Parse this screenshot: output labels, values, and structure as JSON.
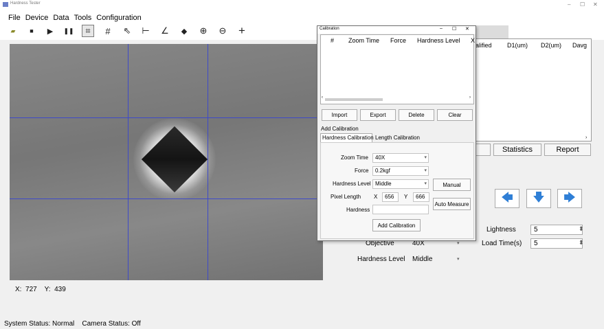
{
  "window": {
    "title": "Hardness Tester",
    "controls": [
      "‒",
      "☐",
      "✕"
    ]
  },
  "menu": [
    "File",
    "Device",
    "Data",
    "Tools",
    "Configuration"
  ],
  "toolbar": [
    {
      "name": "open-icon",
      "glyph": "▰"
    },
    {
      "name": "save-icon",
      "glyph": "■"
    },
    {
      "name": "play-icon",
      "glyph": "▶"
    },
    {
      "name": "pause-icon",
      "glyph": "❚❚"
    },
    {
      "name": "crosshair-grid-icon",
      "glyph": "⌗"
    },
    {
      "name": "grid-icon",
      "glyph": "#"
    },
    {
      "name": "select-arrow-icon",
      "glyph": "⇖"
    },
    {
      "name": "measure-line-icon",
      "glyph": "⊢"
    },
    {
      "name": "angle-icon",
      "glyph": "∠"
    },
    {
      "name": "eraser-icon",
      "glyph": "◆"
    },
    {
      "name": "zoom-in-icon",
      "glyph": "⊕"
    },
    {
      "name": "zoom-out-icon",
      "glyph": "⊖"
    },
    {
      "name": "crosshair-icon",
      "glyph": "+"
    }
  ],
  "coords": {
    "x_label": "X:",
    "x_value": "727",
    "y_label": "Y:",
    "y_value": "439"
  },
  "status": {
    "system": "System Status: Normal",
    "camera": "Camera Status: Off"
  },
  "results_table": {
    "columns": [
      "alified",
      "D1(um)",
      "D2(um)",
      "Davg"
    ]
  },
  "buttons": {
    "statistics": "Statistics",
    "report": "Report"
  },
  "settings": {
    "objective_label": "Objective",
    "objective_value": "40X",
    "hardness_level_label": "Hardness Level",
    "hardness_level_value": "Middle",
    "lightness_label": "Lightness",
    "lightness_value": "5",
    "load_time_label": "Load Time(s)",
    "load_time_value": "5"
  },
  "arrows": [
    {
      "name": "arrow-left-icon",
      "glyph": "🡄"
    },
    {
      "name": "arrow-down-icon",
      "glyph": "🡇"
    },
    {
      "name": "arrow-right-icon",
      "glyph": "🡆"
    }
  ],
  "dialog": {
    "title": "Calibration",
    "columns": [
      "#",
      "Zoom Time",
      "Force",
      "Hardness Level",
      "X"
    ],
    "buttons": {
      "import": "Import",
      "export": "Export",
      "delete": "Delete",
      "clear": "Clear"
    },
    "add_section": "Add Calibration",
    "tabs": [
      "Hardness Calibration",
      "Length Calibration"
    ],
    "zoom_time_label": "Zoom Time",
    "zoom_time_value": "40X",
    "force_label": "Force",
    "force_value": "0.2kgf",
    "hardness_level_label": "Hardness Level",
    "hardness_level_value": "Middle",
    "manual": "Manual",
    "pixel_length_label": "Pixel Length",
    "x_label": "X",
    "x_value": "656",
    "y_label": "Y",
    "y_value": "666",
    "auto_measure": "Auto Measure",
    "hardness_label": "Hardness",
    "hardness_value": "",
    "add_button": "Add Calibration"
  },
  "colors": {
    "grid": "#3d49c9",
    "arrow": "#2f7fd6"
  }
}
